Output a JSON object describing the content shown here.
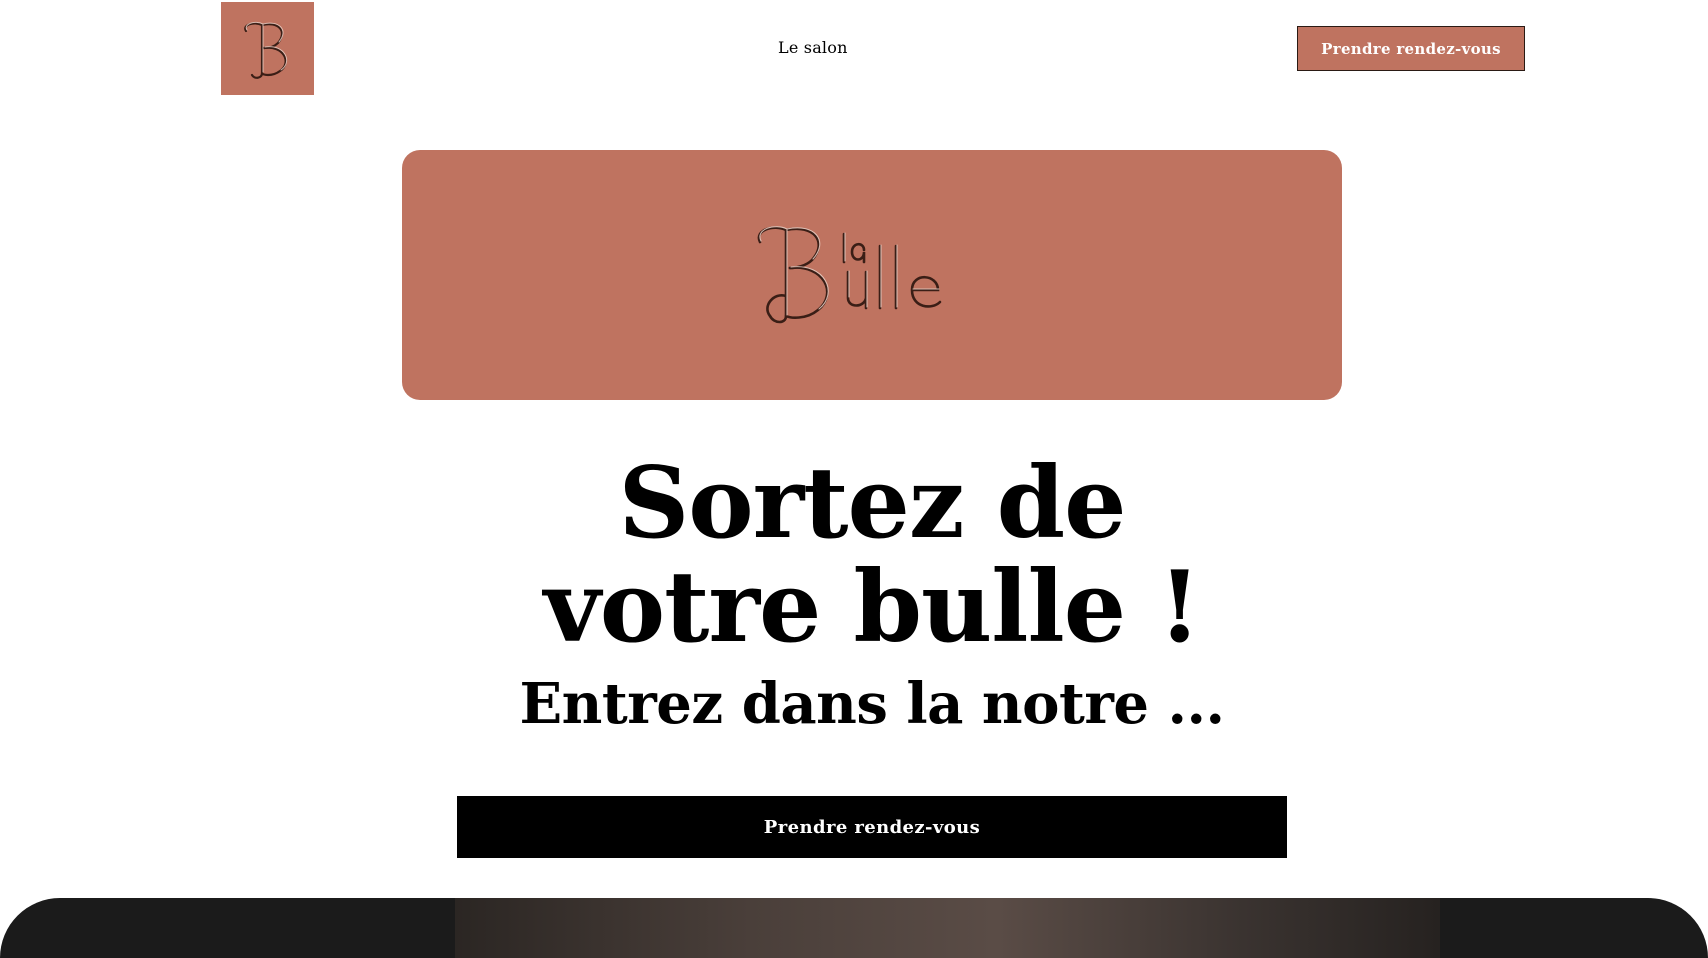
{
  "header": {
    "logo_alt": "B",
    "nav_items": [
      {
        "label": "Le salon"
      }
    ],
    "cta_label": "Prendre rendez-vous"
  },
  "hero": {
    "brand_logo_text_small": "la",
    "brand_logo_text_large": "Bulle",
    "headline_line1": "Sortez de",
    "headline_line2": "votre bulle !",
    "subheadline": "Entrez dans la notre ...",
    "cta_label": "Prendre rendez-vous"
  },
  "colors": {
    "brand_terracotta": "#bf7360",
    "cta_dark": "#000000",
    "background": "#ffffff",
    "bottom_section": "#1b1b1b"
  },
  "icons": {
    "header_logo": "monogram-b-logo",
    "hero_logo": "la-bulle-wordmark-logo"
  }
}
